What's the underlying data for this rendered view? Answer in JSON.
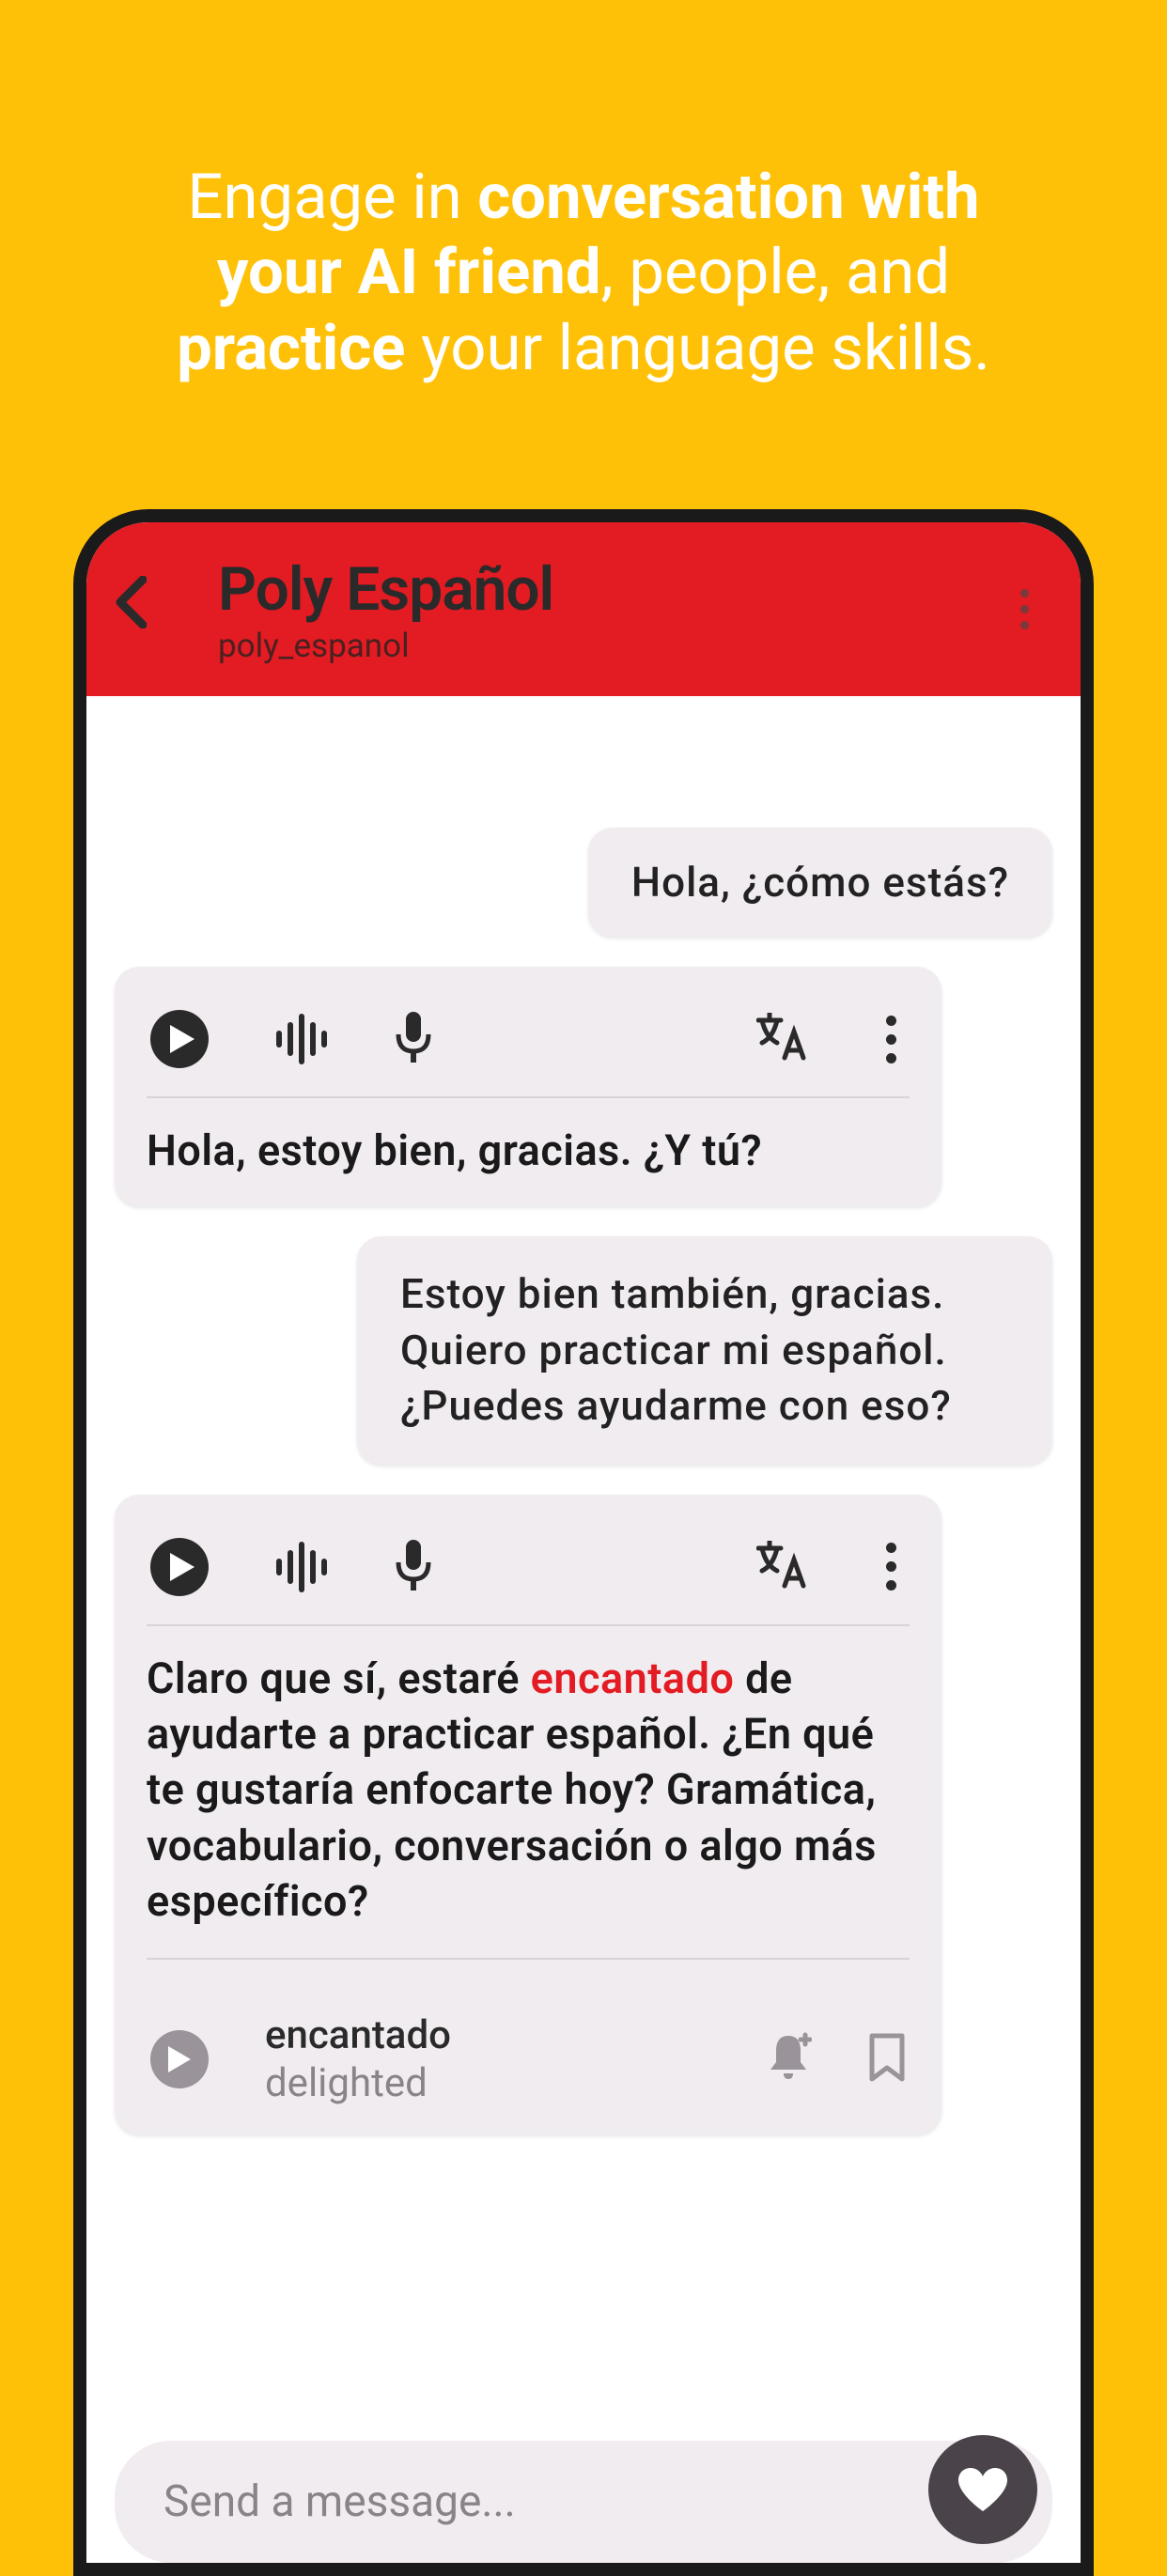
{
  "promo": {
    "p1": "Engage in ",
    "b1": "conversation with your AI friend",
    "p2": ", people, and ",
    "b2": "practice",
    "p3": " your language skills."
  },
  "header": {
    "title": "Poly Español",
    "subtitle": "poly_espanol"
  },
  "messages": {
    "user1": "Hola, ¿cómo estás?",
    "ai1": "Hola, estoy bien, gracias. ¿Y tú?",
    "user2": "Estoy bien también, gracias. Quiero practicar mi español. ¿Puedes ayudarme con eso?",
    "ai2_p1": "Claro que sí, estaré ",
    "ai2_hl": "encantado",
    "ai2_p2": " de ayudarte a practicar español. ¿En qué te gustaría enfocarte hoy? Gramática, vocabulario, conversación o algo más específico?"
  },
  "vocab": {
    "word": "encantado",
    "translation": "delighted"
  },
  "input": {
    "placeholder": "Send a message..."
  }
}
